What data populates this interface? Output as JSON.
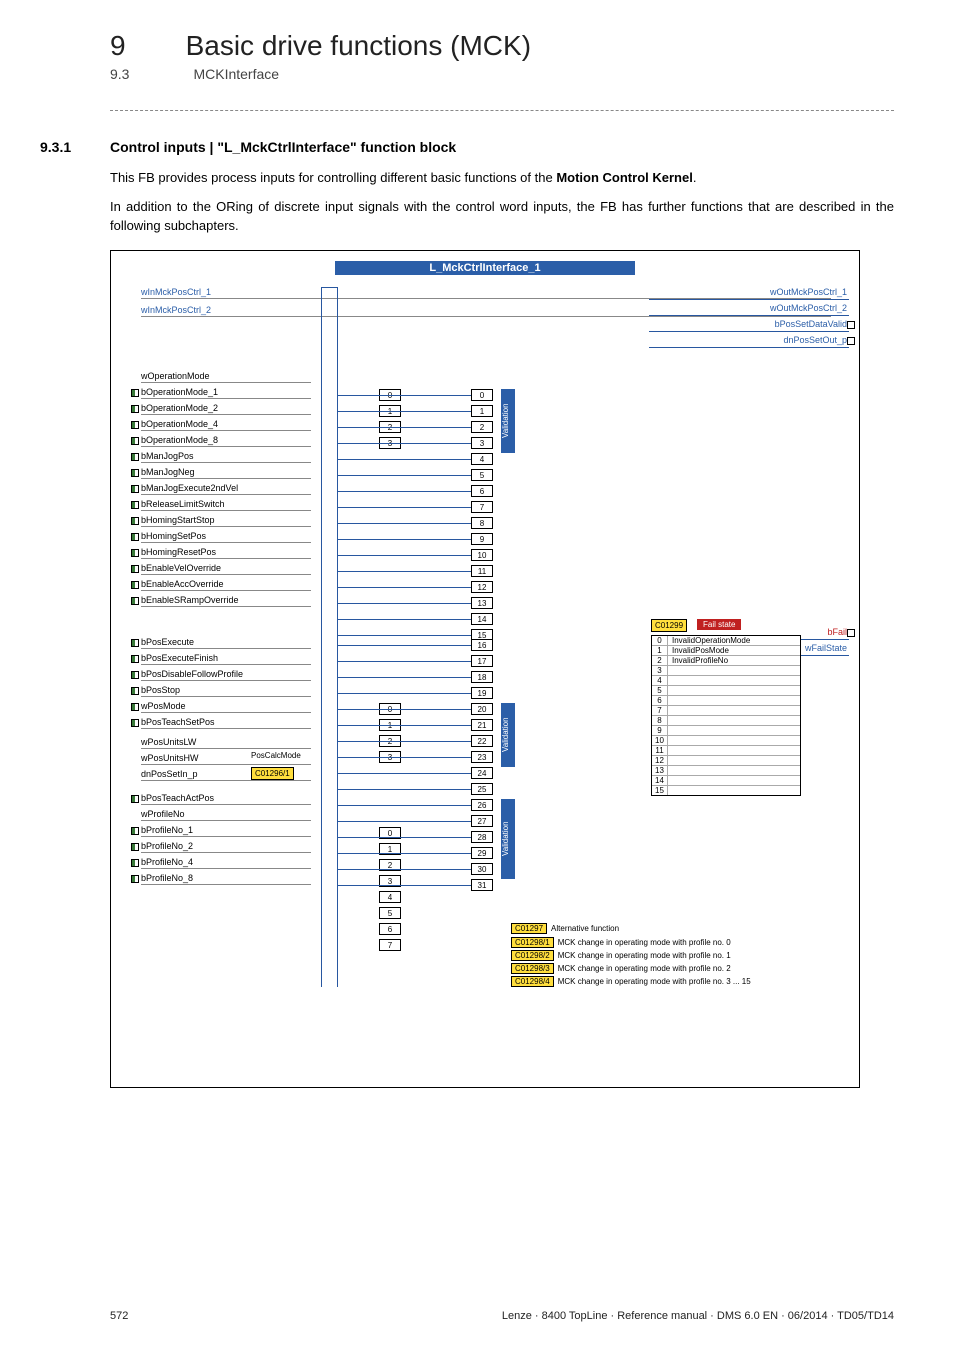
{
  "chapter": {
    "num": "9",
    "title": "Basic drive functions (MCK)"
  },
  "subsection": {
    "num": "9.3",
    "title": "MCKInterface"
  },
  "section": {
    "num": "9.3.1",
    "title": "Control inputs | \"L_MckCtrlInterface\" function block"
  },
  "para1_a": "This FB provides process inputs for controlling different basic functions of the ",
  "para1_b": "Motion Control Kernel",
  "para1_c": ".",
  "para2": "In addition to the ORing of discrete input signals with the control word inputs, the FB has further functions that are described in the following subchapters.",
  "diagram_title": "L_MckCtrlInterface_1",
  "inputs_top": [
    "wInMckPosCtrl_1",
    "wInMckPosCtrl_2"
  ],
  "inputs_main": [
    "wOperationMode",
    "bOperationMode_1",
    "bOperationMode_2",
    "bOperationMode_4",
    "bOperationMode_8",
    "bManJogPos",
    "bManJogNeg",
    "bManJogExecute2ndVel",
    "bReleaseLimitSwitch",
    "bHomingStartStop",
    "bHomingSetPos",
    "bHomingResetPos",
    "bEnableVelOverride",
    "bEnableAccOverride",
    "bEnableSRampOverride"
  ],
  "inputs_pos": [
    "bPosExecute",
    "bPosExecuteFinish",
    "bPosDisableFollowProfile",
    "bPosStop",
    "wPosMode",
    "bPosTeachSetPos"
  ],
  "inputs_units": [
    "wPosUnitsLW",
    "wPosUnitsHW",
    "dnPosSetIn_p"
  ],
  "inputs_profile": [
    "bPosTeachActPos",
    "wProfileNo",
    "bProfileNo_1",
    "bProfileNo_2",
    "bProfileNo_4",
    "bProfileNo_8"
  ],
  "outputs_top": [
    "wOutMckPosCtrl_1",
    "wOutMckPosCtrl_2",
    "bPosSetDataValid",
    "dnPosSetOut_p"
  ],
  "outputs_fail": [
    "bFail",
    "wFailState"
  ],
  "encoder4_a": [
    "0",
    "1",
    "2",
    "3"
  ],
  "encoder4_b": [
    "0",
    "1",
    "2",
    "3"
  ],
  "encoder8": [
    "0",
    "1",
    "2",
    "3",
    "4",
    "5",
    "6",
    "7"
  ],
  "mux_a": [
    "0",
    "1",
    "2",
    "3",
    "4",
    "5",
    "6",
    "7",
    "8",
    "9",
    "10",
    "11",
    "12",
    "13",
    "14",
    "15"
  ],
  "mux_b": [
    "16",
    "17",
    "18",
    "19",
    "20",
    "21",
    "22",
    "23",
    "24",
    "25",
    "26",
    "27",
    "28",
    "29",
    "30",
    "31"
  ],
  "validation_label": "Validation",
  "pos_calc_mode": "PosCalcMode",
  "c01296": "C01296/1",
  "fail_header_code": "C01299",
  "fail_header_text": "Fail state",
  "fail_rows": [
    {
      "n": "0",
      "t": "InvalidOperationMode"
    },
    {
      "n": "1",
      "t": "InvalidPosMode"
    },
    {
      "n": "2",
      "t": "InvalidProfileNo"
    },
    {
      "n": "3",
      "t": ""
    },
    {
      "n": "4",
      "t": ""
    },
    {
      "n": "5",
      "t": ""
    },
    {
      "n": "6",
      "t": ""
    },
    {
      "n": "7",
      "t": ""
    },
    {
      "n": "8",
      "t": ""
    },
    {
      "n": "9",
      "t": ""
    },
    {
      "n": "10",
      "t": ""
    },
    {
      "n": "11",
      "t": ""
    },
    {
      "n": "12",
      "t": ""
    },
    {
      "n": "13",
      "t": ""
    },
    {
      "n": "14",
      "t": ""
    },
    {
      "n": "15",
      "t": ""
    }
  ],
  "alt_header_code": "C01297",
  "alt_header_text": "Alternative function",
  "alt_rows": [
    {
      "c": "C01298/1",
      "t": "MCK change in operating mode with profile no. 0"
    },
    {
      "c": "C01298/2",
      "t": "MCK change in operating mode with profile no. 1"
    },
    {
      "c": "C01298/3",
      "t": "MCK change in operating mode with profile no. 2"
    },
    {
      "c": "C01298/4",
      "t": "MCK change in operating mode with profile no. 3 ... 15"
    }
  ],
  "footer": {
    "page": "572",
    "text": "Lenze · 8400 TopLine · Reference manual · DMS 6.0 EN · 06/2014 · TD05/TD14"
  }
}
